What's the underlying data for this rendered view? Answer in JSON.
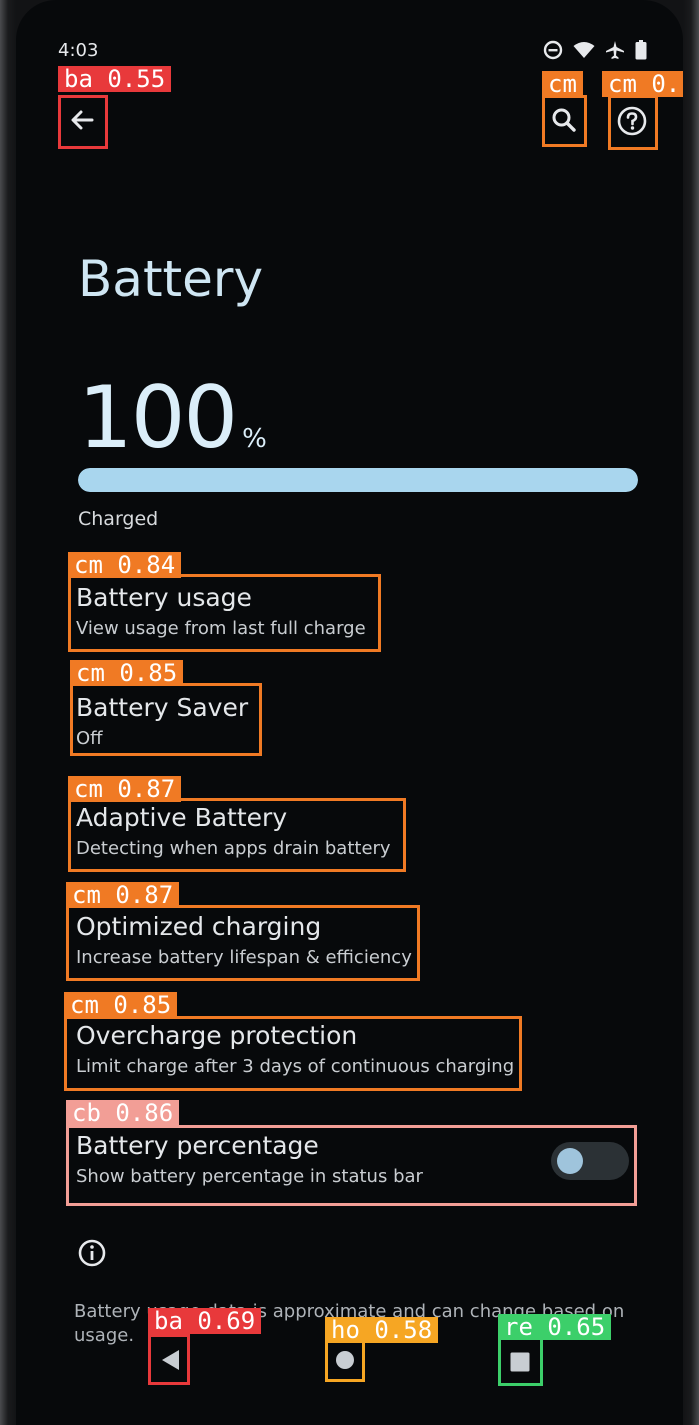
{
  "status_bar": {
    "time": "4:03",
    "icons": [
      "do-not-disturb-icon",
      "wifi-icon",
      "airplane-icon",
      "battery-icon"
    ]
  },
  "toolbar": {
    "back_icon": "arrow-left-icon",
    "search_icon": "search-icon",
    "help_icon": "help-circle-icon"
  },
  "page": {
    "title": "Battery",
    "level_value": "100",
    "level_unit": "%",
    "level_fraction": 1.0,
    "status": "Charged"
  },
  "settings": [
    {
      "title": "Battery usage",
      "subtitle": "View usage from last full charge"
    },
    {
      "title": "Battery Saver",
      "subtitle": "Off"
    },
    {
      "title": "Adaptive Battery",
      "subtitle": "Detecting when apps drain battery"
    },
    {
      "title": "Optimized charging",
      "subtitle": "Increase battery lifespan & efficiency"
    },
    {
      "title": "Overcharge protection",
      "subtitle": "Limit charge after 3 days of continuous charging"
    },
    {
      "title": "Battery percentage",
      "subtitle": "Show battery percentage in status bar",
      "toggle_on": false
    }
  ],
  "footer": {
    "info_icon": "info-icon",
    "note": "Battery usage data is approximate and can change based on usage."
  },
  "nav_bar": {
    "back_icon": "triangle-back-icon",
    "home_icon": "circle-home-icon",
    "recents_icon": "square-recents-icon"
  },
  "detections": [
    {
      "label": "ba",
      "score": "0.55"
    },
    {
      "label": "cm",
      "score": ""
    },
    {
      "label": "cm",
      "score": "0."
    },
    {
      "label": "cm",
      "score": "0.84"
    },
    {
      "label": "cm",
      "score": "0.85"
    },
    {
      "label": "cm",
      "score": "0.87"
    },
    {
      "label": "cm",
      "score": "0.87"
    },
    {
      "label": "cm",
      "score": "0.85"
    },
    {
      "label": "cb",
      "score": "0.86"
    },
    {
      "label": "ba",
      "score": "0.69"
    },
    {
      "label": "ho",
      "score": "0.58"
    },
    {
      "label": "re",
      "score": "0.65"
    }
  ],
  "colors": {
    "background": "#07090b",
    "accent": "#a9d6ee",
    "det_ba": "#e8393b",
    "det_cm": "#f07a24",
    "det_cb": "#f29e96",
    "det_ho": "#f6a623",
    "det_re": "#3ccf6a"
  }
}
